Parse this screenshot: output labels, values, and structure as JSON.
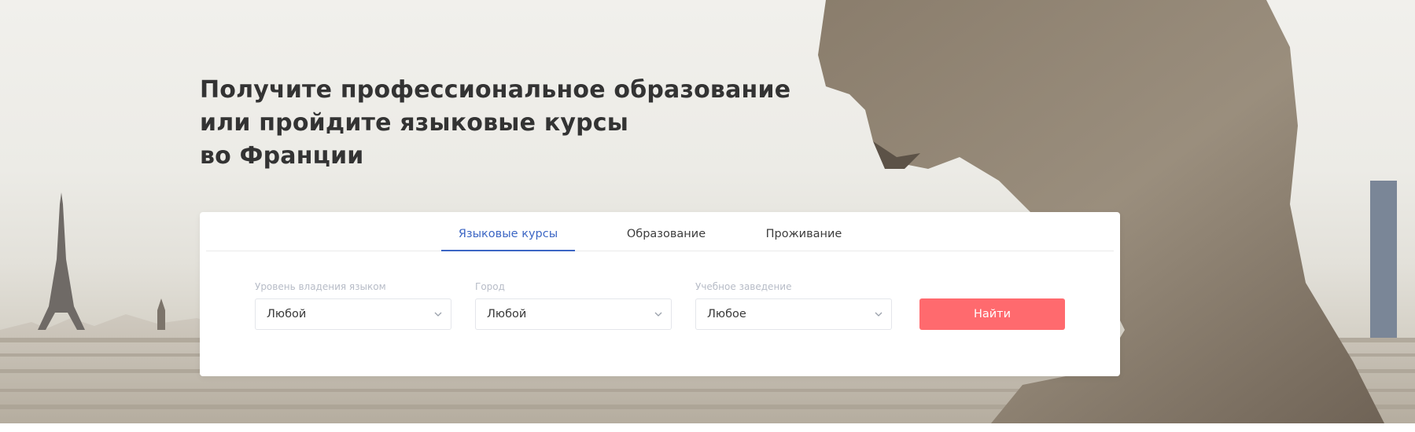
{
  "hero": {
    "headline": [
      "Получите профессиональное образование",
      "или пройдите языковые курсы",
      "во Франции"
    ]
  },
  "search": {
    "tabs": [
      {
        "label": "Языковые курсы",
        "active": true
      },
      {
        "label": "Образование",
        "active": false
      },
      {
        "label": "Проживание",
        "active": false
      }
    ],
    "fields": [
      {
        "label": "Уровень владения языком",
        "value": "Любой"
      },
      {
        "label": "Город",
        "value": "Любой"
      },
      {
        "label": "Учебное заведение",
        "value": "Любое"
      }
    ],
    "button_label": "Найти"
  },
  "colors": {
    "accent_tab": "#3c66c4",
    "button": "#ff6a6e",
    "headline": "#333333"
  },
  "icons": {
    "select_arrow": "chevron-down-icon"
  }
}
